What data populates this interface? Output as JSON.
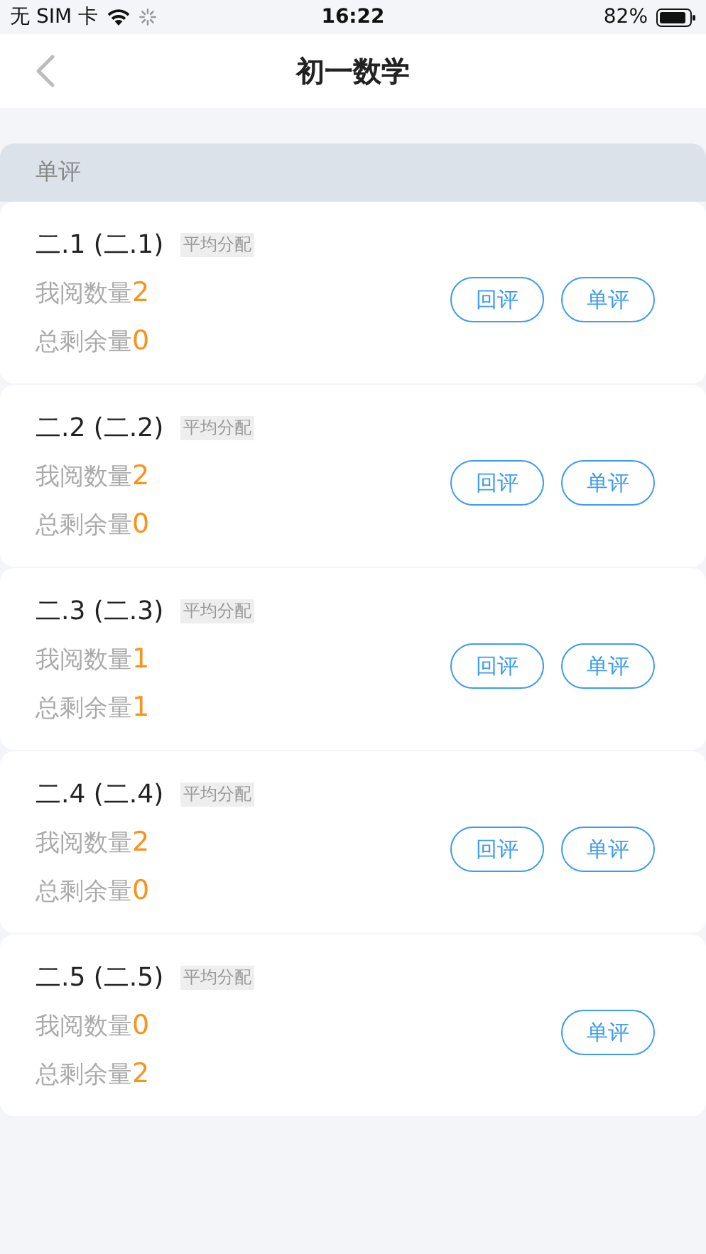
{
  "status_bar": {
    "carrier": "无 SIM 卡",
    "time": "16:22",
    "battery": "82%"
  },
  "nav": {
    "title": "初一数学"
  },
  "section": {
    "title": "单评"
  },
  "items": [
    {
      "title": "二.1 (二.1)",
      "tag": "平均分配",
      "read_label": "我阅数量",
      "read_count": "2",
      "remain_label": "总剩余量",
      "remain_count": "0",
      "buttons": [
        "回评",
        "单评"
      ]
    },
    {
      "title": "二.2 (二.2)",
      "tag": "平均分配",
      "read_label": "我阅数量",
      "read_count": "2",
      "remain_label": "总剩余量",
      "remain_count": "0",
      "buttons": [
        "回评",
        "单评"
      ]
    },
    {
      "title": "二.3 (二.3)",
      "tag": "平均分配",
      "read_label": "我阅数量",
      "read_count": "1",
      "remain_label": "总剩余量",
      "remain_count": "1",
      "buttons": [
        "回评",
        "单评"
      ]
    },
    {
      "title": "二.4 (二.4)",
      "tag": "平均分配",
      "read_label": "我阅数量",
      "read_count": "2",
      "remain_label": "总剩余量",
      "remain_count": "0",
      "buttons": [
        "回评",
        "单评"
      ]
    },
    {
      "title": "二.5 (二.5)",
      "tag": "平均分配",
      "read_label": "我阅数量",
      "read_count": "0",
      "remain_label": "总剩余量",
      "remain_count": "2",
      "buttons": [
        "单评"
      ]
    }
  ]
}
